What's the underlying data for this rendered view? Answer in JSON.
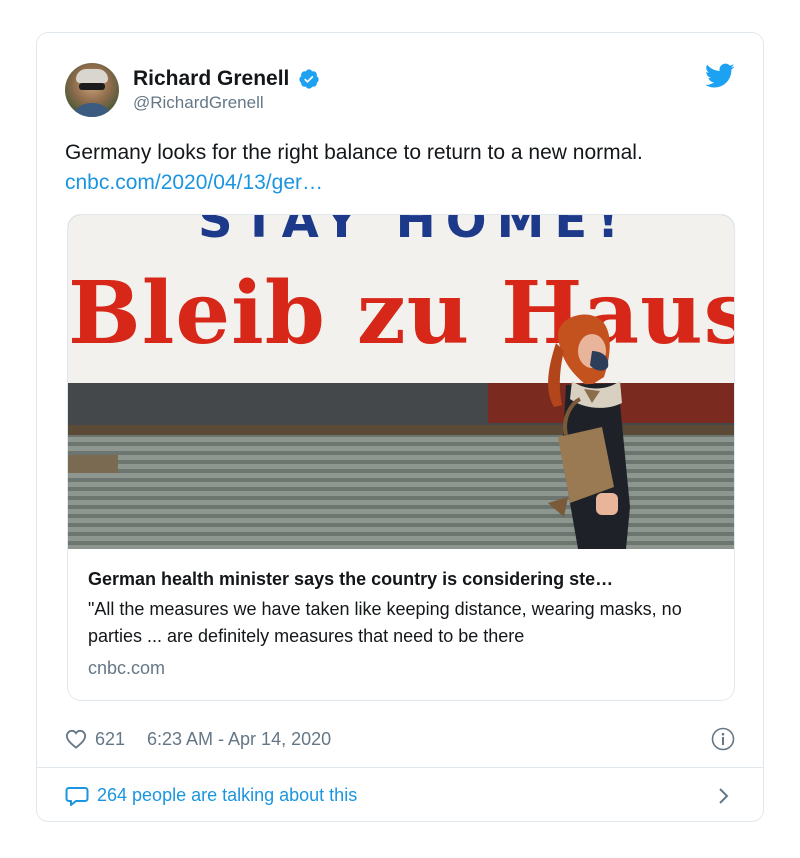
{
  "author": {
    "display_name": "Richard Grenell",
    "handle": "@RichardGrenell",
    "verified": true,
    "avatar_icon": "avatar"
  },
  "tweet": {
    "text": "Germany looks for the right balance to return to a new normal.",
    "link": "cnbc.com/2020/04/13/ger…"
  },
  "link_card": {
    "image_banner_top": "STAY HOME!",
    "image_banner_main": "Bleib zu Hause",
    "title": "German health minister says the country is considering ste…",
    "description": "\"All the measures we have taken like keeping distance, wearing masks, no parties ... are definitely measures that need to be there",
    "domain": "cnbc.com"
  },
  "meta": {
    "likes": "621",
    "timestamp": "6:23 AM - Apr 14, 2020"
  },
  "conversation": {
    "label": "264 people are talking about this"
  },
  "colors": {
    "link": "#1b95e0",
    "verified": "#1da1f2",
    "muted": "#657786",
    "border": "#e1e8ed"
  }
}
